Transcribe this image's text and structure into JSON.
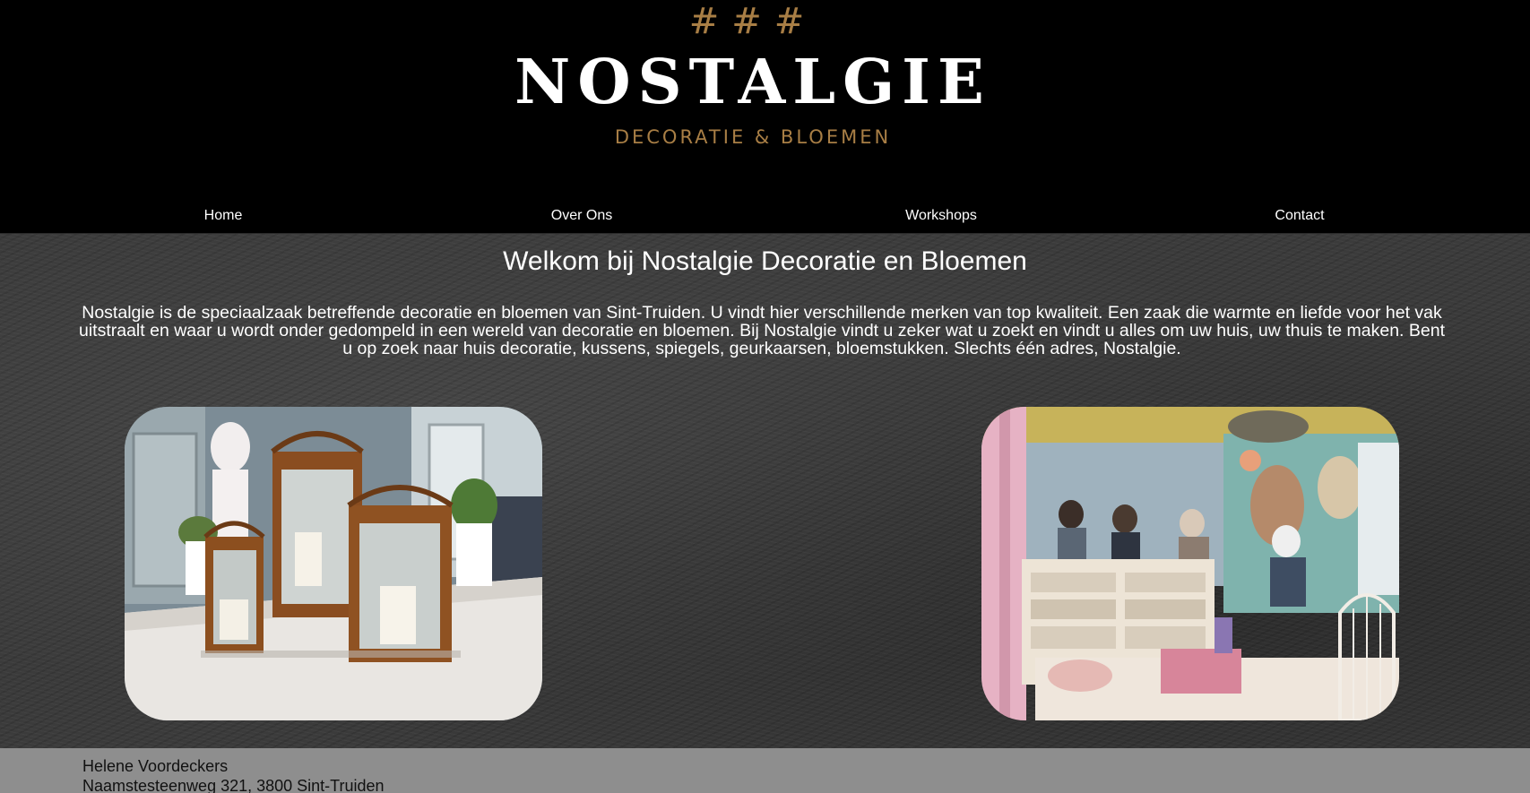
{
  "logo": {
    "hashes": "###",
    "name": "NOSTALGIE",
    "subtitle": "DECORATIE & BLOEMEN"
  },
  "nav": {
    "items": [
      {
        "label": "Home"
      },
      {
        "label": "Over Ons"
      },
      {
        "label": "Workshops"
      },
      {
        "label": "Contact"
      }
    ]
  },
  "main": {
    "title": "Welkom bij Nostalgie Decoratie en Bloemen",
    "intro": "Nostalgie is de speciaalzaak betreffende decoratie en bloemen van Sint-Truiden. U vindt hier verschillende merken van top kwaliteit. Een zaak die warmte en liefde voor het vak uitstraalt en waar u wordt onder gedompeld in een wereld van decoratie en bloemen. Bij Nostalgie vindt u zeker wat u zoekt en vindt u alles om uw huis, uw thuis te maken. Bent u op zoek naar huis decoratie, kussens, spiegels, geurkaarsen, bloemstukken. Slechts één adres, Nostalgie."
  },
  "photos": [
    {
      "subject": "lanterns-photo"
    },
    {
      "subject": "shop-interior-photo"
    }
  ],
  "footer": {
    "name": "Helene Voordeckers",
    "address": "Naamstesteenweg 321, 3800 Sint-Truiden"
  },
  "colors": {
    "header_bg": "#000000",
    "brand_gold": "#a87e45",
    "content_bg": "#3b3b3b",
    "footer_bg": "#8e8e8e"
  }
}
